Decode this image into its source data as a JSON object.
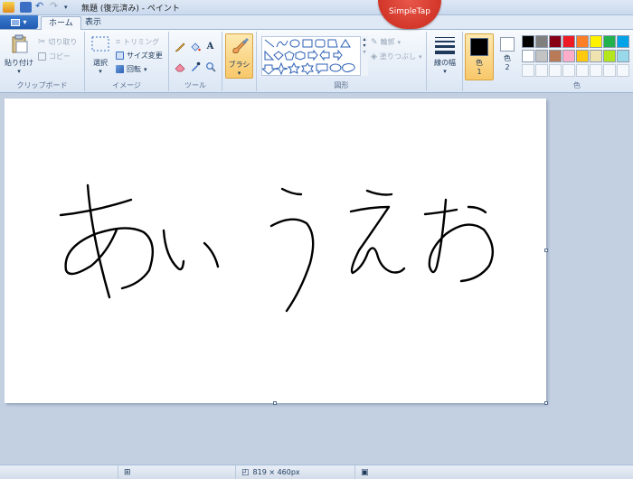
{
  "window": {
    "title": "無題 (復元済み) - ペイント"
  },
  "badge": {
    "text": "SimpleTap"
  },
  "tabs": [
    {
      "label": "ホーム"
    },
    {
      "label": "表示"
    }
  ],
  "clipboard": {
    "paste_label": "貼り付け",
    "cut_label": "切り取り",
    "copy_label": "コピー",
    "group_label": "クリップボード"
  },
  "image": {
    "select_label": "選択",
    "crop_label": "トリミング",
    "resize_label": "サイズ変更",
    "rotate_label": "回転",
    "group_label": "イメージ"
  },
  "tools": {
    "group_label": "ツール",
    "icons": [
      "pencil-icon",
      "fill-icon",
      "text-icon",
      "eraser-icon",
      "color-picker-icon",
      "magnifier-icon"
    ]
  },
  "brush": {
    "label": "ブラシ"
  },
  "shapes": {
    "outline_label": "輪郭",
    "fill_label": "塗りつぶし",
    "group_label": "図形"
  },
  "size": {
    "label": "線の幅"
  },
  "colors": {
    "color1_label": "色",
    "color1_number": "1",
    "color2_label": "色",
    "color2_number": "2",
    "group_label": "色",
    "color1_value": "#000000",
    "color2_value": "#ffffff",
    "palette_row1": [
      "#000000",
      "#7f7f7f",
      "#880015",
      "#ed1c24",
      "#ff7f27",
      "#fff200",
      "#22b14c",
      "#00a2e8"
    ],
    "palette_row2": [
      "#ffffff",
      "#c3c3c3",
      "#b97a57",
      "#ffaec9",
      "#ffc90e",
      "#efe4b0",
      "#b5e61d",
      "#99d9ea"
    ]
  },
  "canvas": {
    "drawing_text": "あいうえお"
  },
  "status": {
    "dimensions": "819 × 460px"
  }
}
